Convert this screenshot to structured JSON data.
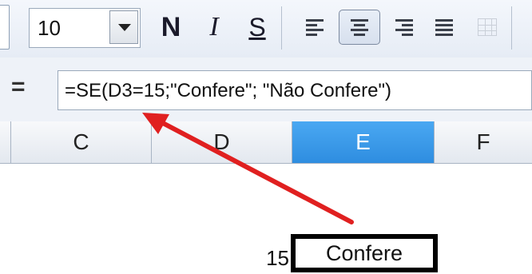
{
  "toolbar": {
    "font_size_value": "10",
    "bold_label": "N",
    "italic_label": "I",
    "underline_label": "S"
  },
  "formula_bar": {
    "equals_symbol": "=",
    "formula_text": "=SE(D3=15;\"Confere\"; \"Não Confere\")"
  },
  "columns": [
    {
      "label": "C",
      "selected": false
    },
    {
      "label": "D",
      "selected": false
    },
    {
      "label": "E",
      "selected": true
    },
    {
      "label": "F",
      "selected": false
    }
  ],
  "cells": {
    "d3_value": "15",
    "e3_value": "Confere"
  },
  "colors": {
    "selected_column": "#2e8de0",
    "annotation_arrow": "#e02020",
    "highlight_box": "#000000"
  }
}
